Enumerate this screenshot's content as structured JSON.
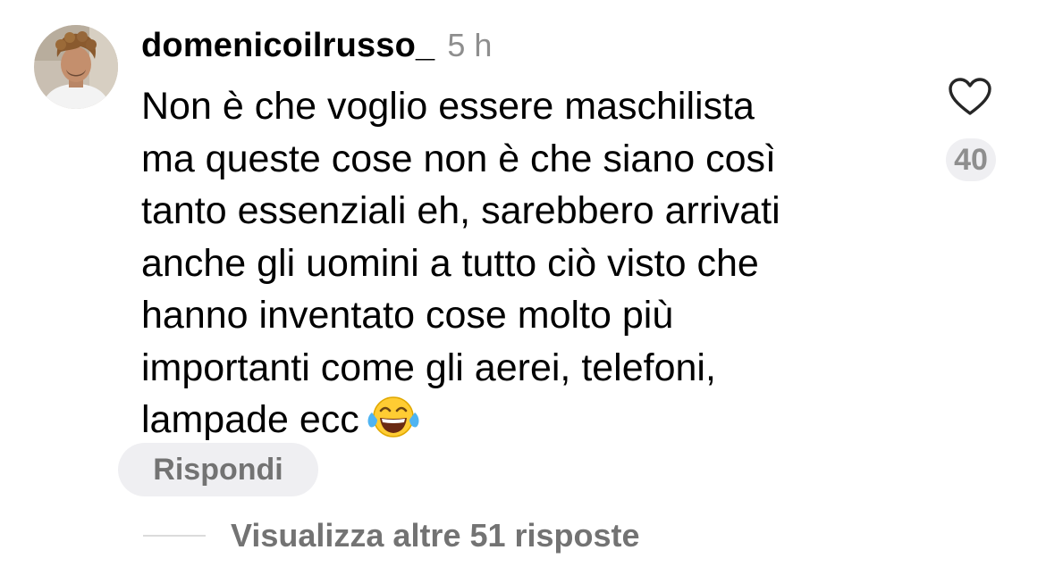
{
  "comment": {
    "username": "domenicoilrusso_",
    "time": "5 h",
    "lines": [
      "Non è che voglio essere maschilista",
      "ma queste cose non è che siano così",
      "tanto essenziali eh, sarebbero arrivati",
      "anche gli uomini a tutto ciò visto che",
      "hanno inventato cose molto più",
      "importanti come gli aerei, telefoni,",
      "lampade ecc"
    ],
    "emoji": "face-with-tears-of-joy",
    "like_icon": "heart-outline-icon",
    "like_count": "40",
    "reply_label": "Rispondi"
  },
  "replies": {
    "view_more_label": "Visualizza altre 51 risposte"
  },
  "colors": {
    "text": "#000000",
    "secondary": "#8e8e8e",
    "pill_bg": "#efeff2",
    "divider": "#dbdbdb"
  }
}
